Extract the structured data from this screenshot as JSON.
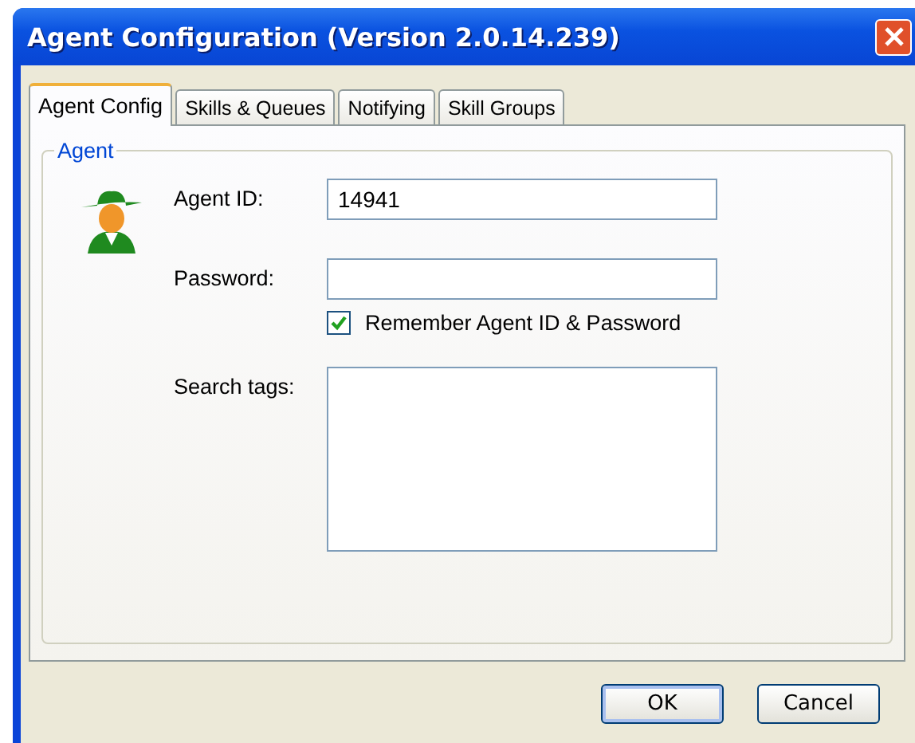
{
  "window": {
    "title": "Agent Configuration (Version 2.0.14.239)"
  },
  "tabs": [
    {
      "label": "Agent Config",
      "selected": true
    },
    {
      "label": "Skills & Queues",
      "selected": false
    },
    {
      "label": "Notifying",
      "selected": false
    },
    {
      "label": "Skill Groups",
      "selected": false
    }
  ],
  "group": {
    "title": "Agent"
  },
  "agent_id": {
    "label": "Agent ID:",
    "value": "14941"
  },
  "password": {
    "label": "Password:"
  },
  "remember": {
    "label": "Remember Agent ID & Password",
    "checked": true
  },
  "search_tags": {
    "label": "Search tags:"
  },
  "buttons": [
    "OK",
    "Cancel"
  ]
}
